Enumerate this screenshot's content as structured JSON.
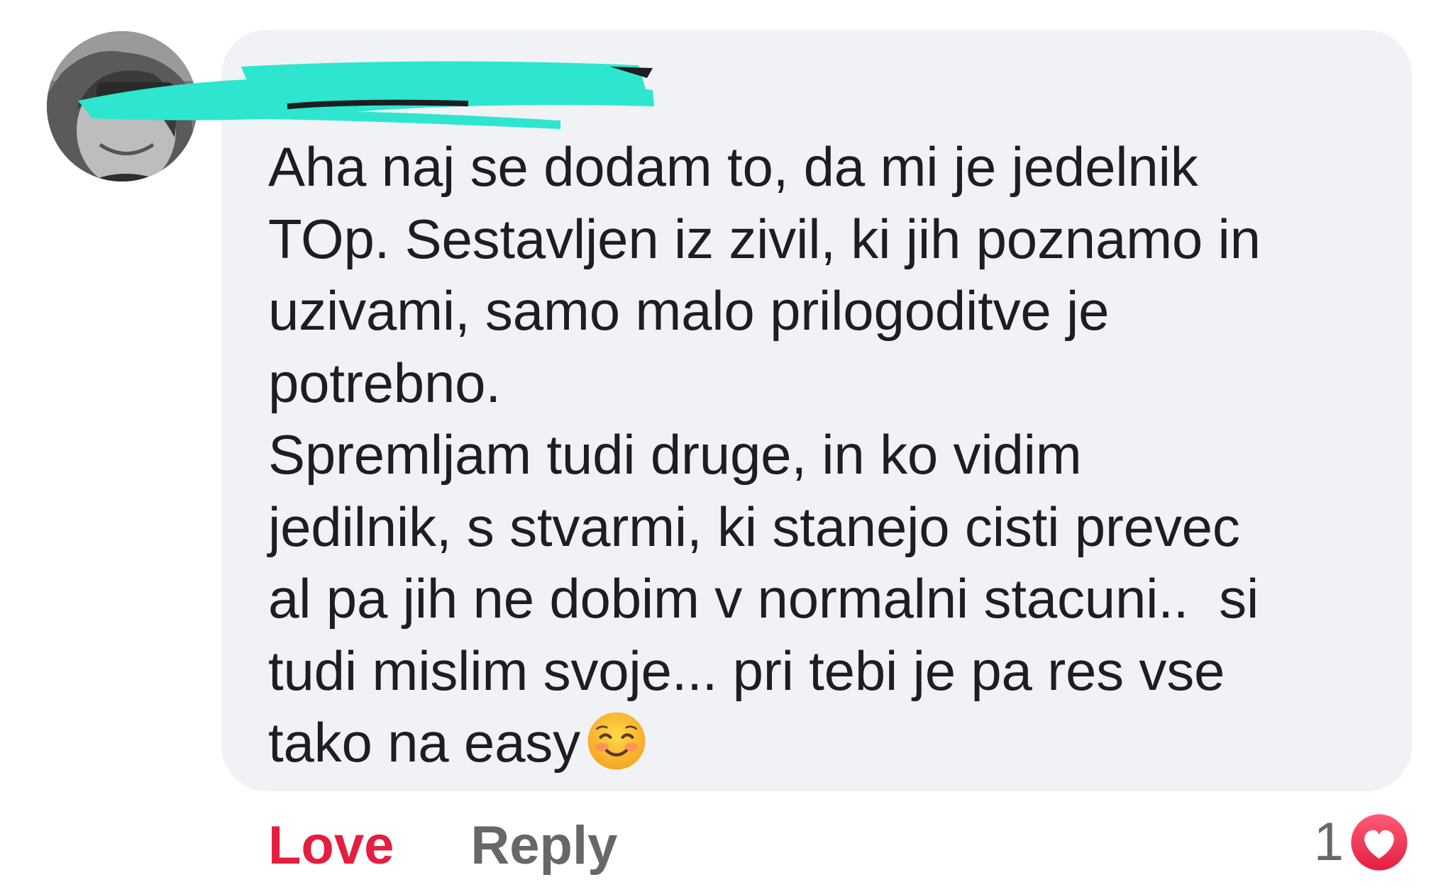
{
  "comment": {
    "author_name": "",
    "text": "Aha naj se dodam to, da mi je jedelnik\nTOp. Sestavljen iz zivil, ki jih poznamo in\nuzivami, samo malo prilogoditve je\npotrebno.\nSpremljam tudi druge, in ko vidim\njedilnik, s stvarmi, ki stanejo cisti prevec\nal pa jih ne dobim v normalni stacuni..  si\ntudi mislim svoje... pri tebi je pa res vse\ntako na easy",
    "emoji": "smiling-face-with-blush"
  },
  "actions": {
    "love_label": "Love",
    "reply_label": "Reply"
  },
  "reactions": {
    "count": "1",
    "icon": "heart-icon"
  },
  "colors": {
    "bubble_bg": "#f0f2f5",
    "text": "#1c1e21",
    "love": "#e41e3f",
    "secondary": "#65676b",
    "redaction": "#2ee6cf"
  }
}
